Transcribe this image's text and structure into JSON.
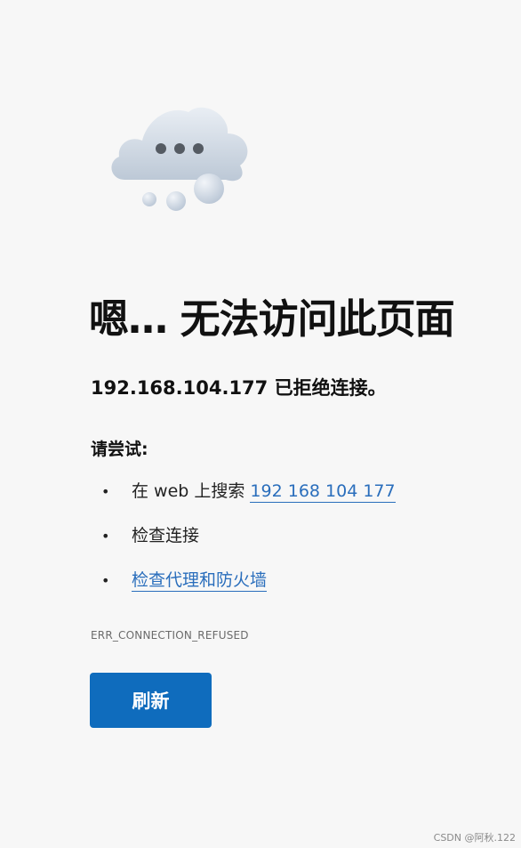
{
  "page": {
    "title": "嗯… 无法访问此页面",
    "subtitle": "192.168.104.177 已拒绝连接。",
    "try_heading": "请尝试:",
    "suggestions": {
      "search_prefix": "在 web 上搜索 ",
      "search_link": "192 168 104 177",
      "check_connection": "检查连接",
      "check_proxy_firewall": "检查代理和防火墙"
    },
    "bullet": "•",
    "error_code": "ERR_CONNECTION_REFUSED",
    "refresh_label": "刷新"
  },
  "watermark": "CSDN @阿秋.122",
  "icons": {
    "illustration": "cloud-loading-icon"
  },
  "colors": {
    "background": "#f7f7f7",
    "link": "#2a6ebc",
    "button": "#0f6cbd",
    "button_text": "#ffffff"
  }
}
